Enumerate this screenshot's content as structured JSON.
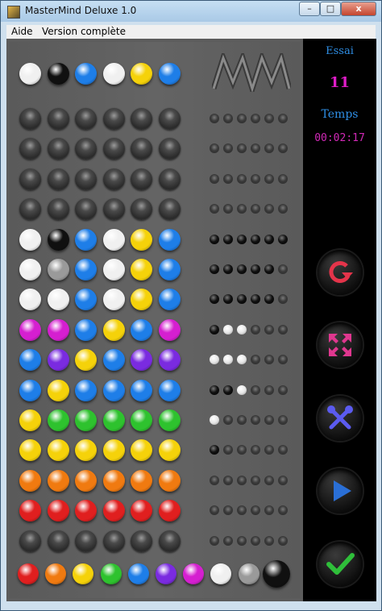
{
  "window": {
    "title": "MasterMind Deluxe 1.0"
  },
  "window_buttons": {
    "minimize": "–",
    "maximize": "□",
    "close": "x"
  },
  "menu": {
    "items": [
      "Aide",
      "Version complète"
    ]
  },
  "side": {
    "essai_label": "Essai",
    "essai_value": "11",
    "temps_label": "Temps",
    "temps_value": "00:02:17",
    "buttons": [
      "restart-icon",
      "fullscreen-icon",
      "settings-tools-icon",
      "play-icon",
      "validate-check-icon"
    ]
  },
  "colors": {
    "white": "#f0f0f0",
    "black": "#101010",
    "blue": "#1e7ee8",
    "yellow": "#f5d20a",
    "magenta": "#d51fd0",
    "violet": "#7a2be0",
    "green": "#2ec22e",
    "orange": "#f07a10",
    "red": "#e01f1f",
    "gray": "#9a9a9a",
    "empty": "#3c3c3c"
  },
  "secret": [
    "white",
    "black",
    "blue",
    "white",
    "yellow",
    "blue"
  ],
  "rows": [
    {
      "pegs": [
        "empty",
        "empty",
        "empty",
        "empty",
        "empty",
        "empty"
      ],
      "keys": [
        "e",
        "e",
        "e",
        "e",
        "e",
        "e"
      ]
    },
    {
      "pegs": [
        "empty",
        "empty",
        "empty",
        "empty",
        "empty",
        "empty"
      ],
      "keys": [
        "e",
        "e",
        "e",
        "e",
        "e",
        "e"
      ]
    },
    {
      "pegs": [
        "empty",
        "empty",
        "empty",
        "empty",
        "empty",
        "empty"
      ],
      "keys": [
        "e",
        "e",
        "e",
        "e",
        "e",
        "e"
      ]
    },
    {
      "pegs": [
        "empty",
        "empty",
        "empty",
        "empty",
        "empty",
        "empty"
      ],
      "keys": [
        "e",
        "e",
        "e",
        "e",
        "e",
        "e"
      ]
    },
    {
      "pegs": [
        "white",
        "black",
        "blue",
        "white",
        "yellow",
        "blue"
      ],
      "keys": [
        "b",
        "b",
        "b",
        "b",
        "b",
        "b"
      ]
    },
    {
      "pegs": [
        "white",
        "gray",
        "blue",
        "white",
        "yellow",
        "blue"
      ],
      "keys": [
        "b",
        "b",
        "b",
        "b",
        "b",
        "e"
      ]
    },
    {
      "pegs": [
        "white",
        "white",
        "blue",
        "white",
        "yellow",
        "blue"
      ],
      "keys": [
        "b",
        "b",
        "b",
        "b",
        "b",
        "e"
      ]
    },
    {
      "pegs": [
        "magenta",
        "magenta",
        "blue",
        "yellow",
        "blue",
        "magenta"
      ],
      "keys": [
        "b",
        "w",
        "w",
        "e",
        "e",
        "e"
      ]
    },
    {
      "pegs": [
        "blue",
        "violet",
        "yellow",
        "blue",
        "violet",
        "violet"
      ],
      "keys": [
        "w",
        "w",
        "w",
        "e",
        "e",
        "e"
      ]
    },
    {
      "pegs": [
        "blue",
        "yellow",
        "blue",
        "blue",
        "blue",
        "blue"
      ],
      "keys": [
        "b",
        "b",
        "w",
        "e",
        "e",
        "e"
      ]
    },
    {
      "pegs": [
        "yellow",
        "green",
        "green",
        "green",
        "green",
        "green"
      ],
      "keys": [
        "w",
        "e",
        "e",
        "e",
        "e",
        "e"
      ]
    },
    {
      "pegs": [
        "yellow",
        "yellow",
        "yellow",
        "yellow",
        "yellow",
        "yellow"
      ],
      "keys": [
        "b",
        "e",
        "e",
        "e",
        "e",
        "e"
      ]
    },
    {
      "pegs": [
        "orange",
        "orange",
        "orange",
        "orange",
        "orange",
        "orange"
      ],
      "keys": [
        "e",
        "e",
        "e",
        "e",
        "e",
        "e"
      ]
    },
    {
      "pegs": [
        "red",
        "red",
        "red",
        "red",
        "red",
        "red"
      ],
      "keys": [
        "e",
        "e",
        "e",
        "e",
        "e",
        "e"
      ]
    },
    {
      "pegs": [
        "empty",
        "empty",
        "empty",
        "empty",
        "empty",
        "empty"
      ],
      "keys": [
        "e",
        "e",
        "e",
        "e",
        "e",
        "e"
      ]
    }
  ],
  "palette": [
    "red",
    "orange",
    "yellow",
    "green",
    "blue",
    "violet",
    "magenta",
    "white",
    "gray",
    "black"
  ],
  "palette_selected": "black"
}
